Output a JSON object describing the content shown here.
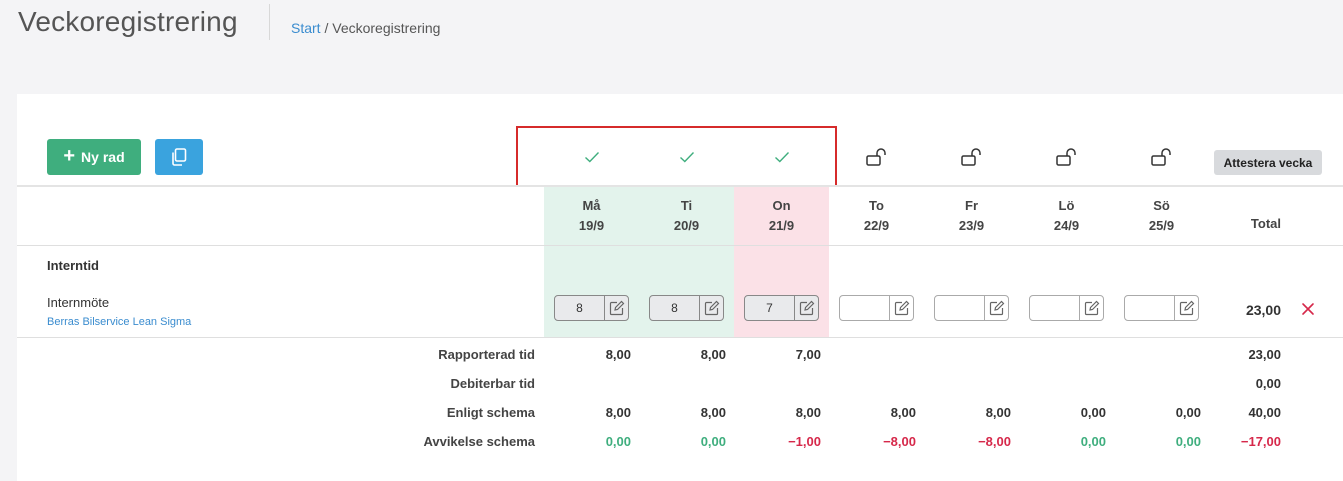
{
  "page": {
    "title": "Veckoregistrering",
    "breadcrumb": {
      "home": "Start",
      "separator": "/",
      "current": "Veckoregistrering"
    }
  },
  "toolbar": {
    "new_row_label": "Ny rad",
    "new_row_icon": "plus-icon",
    "copy_icon": "copy-icon",
    "attest_label": "Attestera vecka"
  },
  "colors": {
    "green": "#3fae7e",
    "blue": "#3aa3de",
    "red": "#d6284a",
    "highlight": "#d62b2b",
    "attested_bg": "#e3f3ec",
    "current_day_bg": "#fbe1e7"
  },
  "days": [
    {
      "name": "Må",
      "date": "19/9",
      "status": "attested",
      "status_icon": "checkmark-icon",
      "value": "8"
    },
    {
      "name": "Ti",
      "date": "20/9",
      "status": "attested",
      "status_icon": "checkmark-icon",
      "value": "8"
    },
    {
      "name": "On",
      "date": "21/9",
      "status": "attested",
      "status_icon": "checkmark-icon",
      "value": "7"
    },
    {
      "name": "To",
      "date": "22/9",
      "status": "unlocked",
      "status_icon": "unlock-icon",
      "value": ""
    },
    {
      "name": "Fr",
      "date": "23/9",
      "status": "unlocked",
      "status_icon": "unlock-icon",
      "value": ""
    },
    {
      "name": "Lö",
      "date": "24/9",
      "status": "unlocked",
      "status_icon": "unlock-icon",
      "value": ""
    },
    {
      "name": "Sö",
      "date": "25/9",
      "status": "unlocked",
      "status_icon": "unlock-icon",
      "value": ""
    }
  ],
  "total_header": "Total",
  "group": {
    "label": "Interntid",
    "row": {
      "title": "Internmöte",
      "subtitle": "Berras Bilservice Lean Sigma",
      "total": "23,00",
      "delete_icon": "close-icon"
    }
  },
  "summary": [
    {
      "label": "Rapporterad tid",
      "values": [
        "8,00",
        "8,00",
        "7,00",
        "",
        "",
        "",
        ""
      ],
      "total": "23,00"
    },
    {
      "label": "Debiterbar tid",
      "values": [
        "",
        "",
        "",
        "",
        "",
        "",
        ""
      ],
      "total": "0,00"
    },
    {
      "label": "Enligt schema",
      "values": [
        "8,00",
        "8,00",
        "8,00",
        "8,00",
        "8,00",
        "0,00",
        "0,00"
      ],
      "total": "40,00"
    },
    {
      "label": "Avvikelse schema",
      "values": [
        "0,00",
        "0,00",
        "−1,00",
        "−8,00",
        "−8,00",
        "0,00",
        "0,00"
      ],
      "total": "−17,00",
      "signed": true
    }
  ]
}
